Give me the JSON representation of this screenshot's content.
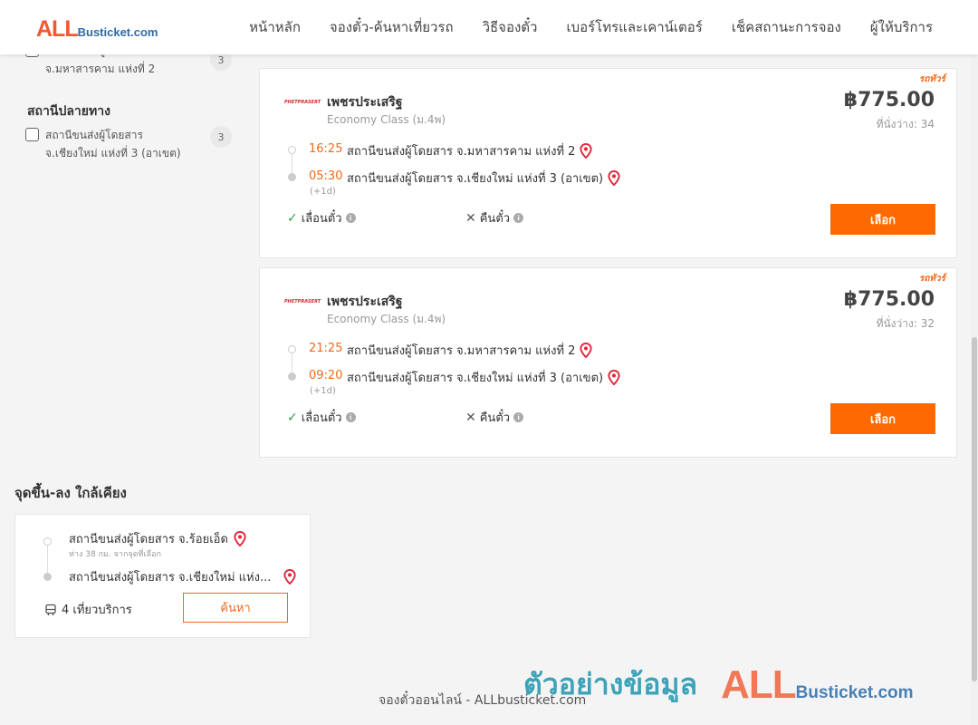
{
  "header": {
    "logo_big": "ALL",
    "logo_small": "Busticket.com",
    "nav": [
      "หน้าหลัก",
      "จองตั๋ว-ค้นหาเที่ยวรถ",
      "วิธีจองตั๋ว",
      "เบอร์โทรและเคาน์เตอร์",
      "เช็คสถานะการจอง",
      "ผู้ให้บริการ"
    ]
  },
  "sidebar": {
    "origin_item": {
      "line1": "สถานีขนส่งผู้โดยสาร",
      "line2": "จ.มหาสารคาม แห่งที่ 2",
      "count": "3"
    },
    "destination_title": "สถานีปลายทาง",
    "destination_item": {
      "line1": "สถานีขนส่งผู้โดยสาร",
      "line2": "จ.เชียงใหม่ แห่งที่ 3 (อาเขต)",
      "count": "3"
    }
  },
  "trips": [
    {
      "tag": "รถทัวร์",
      "operator_logo": "PHETPRASERT",
      "operator": "เพชรประเสริฐ",
      "class": "Economy Class (ม.4พ)",
      "price": "฿775.00",
      "seats": "ที่นั่งว่าง: 34",
      "depart_time": "16:25",
      "depart_stop": "สถานีขนส่งผู้โดยสาร จ.มหาสารคาม แห่งที่ 2",
      "arrive_time": "05:30",
      "arrive_stop": "สถานีขนส่งผู้โดยสาร จ.เชียงใหม่ แห่งที่ 3 (อาเขต)",
      "day_offset": "(+1d)",
      "change_policy": "เลื่อนตั๋ว",
      "refund_policy": "คืนตั๋ว",
      "select_label": "เลือก"
    },
    {
      "tag": "รถทัวร์",
      "operator_logo": "PHETPRASERT",
      "operator": "เพชรประเสริฐ",
      "class": "Economy Class (ม.4พ)",
      "price": "฿775.00",
      "seats": "ที่นั่งว่าง: 32",
      "depart_time": "21:25",
      "depart_stop": "สถานีขนส่งผู้โดยสาร จ.มหาสารคาม แห่งที่ 2",
      "arrive_time": "09:20",
      "arrive_stop": "สถานีขนส่งผู้โดยสาร จ.เชียงใหม่ แห่งที่ 3 (อาเขต)",
      "day_offset": "(+1d)",
      "change_policy": "เลื่อนตั๋ว",
      "refund_policy": "คืนตั๋ว",
      "select_label": "เลือก"
    }
  ],
  "nearby": {
    "title": "จุดขึ้น-ลง ใกล้เคียง",
    "from": "สถานีขนส่งผู้โดยสาร จ.ร้อยเอ็ด",
    "distance": "ห่าง 38 กม. จากจุดที่เลือก",
    "to": "สถานีขนส่งผู้โดยสาร จ.เชียงใหม่ แห่ง...",
    "trips": "4 เที่ยวบริการ",
    "search_label": "ค้นหา"
  },
  "footer": {
    "text": "จองตั๋วออนไลน์ - ALLbusticket.com",
    "watermark_thai": "ตัวอย่างข้อมูล",
    "watermark_big": "ALL",
    "watermark_small": "Busticket.com"
  },
  "colors": {
    "accent": "#ff6a00",
    "time": "#ef6a1a",
    "pin": "#e0263a",
    "check": "#2ea043"
  }
}
